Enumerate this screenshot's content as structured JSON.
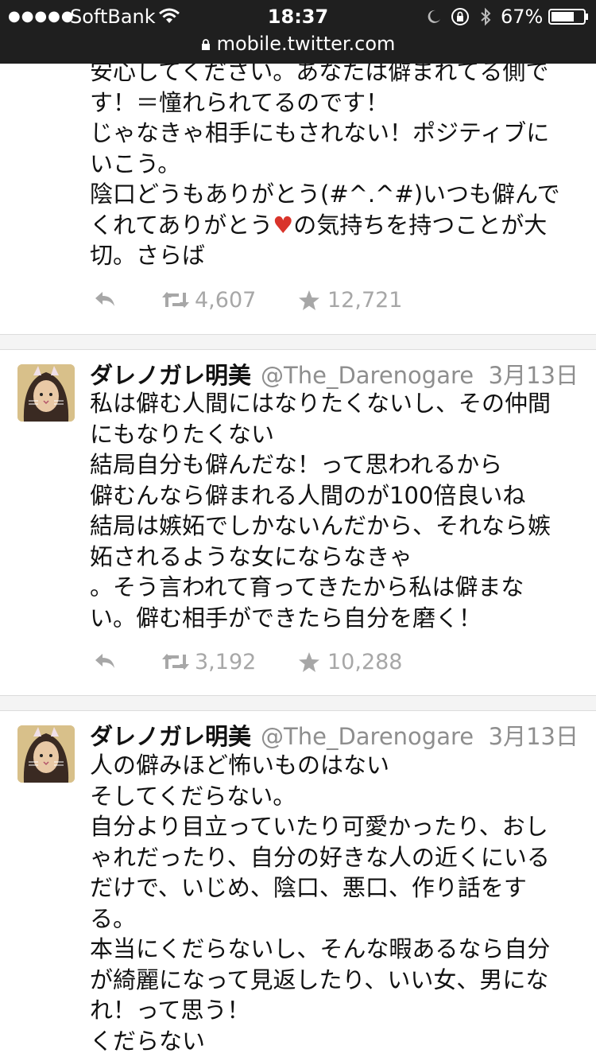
{
  "status_bar": {
    "signal": "●●●●●",
    "carrier": "SoftBank",
    "time": "18:37",
    "battery": "67%",
    "url": "mobile.twitter.com"
  },
  "tweets": [
    {
      "text": "安心してください。あなたは僻まれてる側です！＝憧れられてるのです！\nじゃなきゃ相手にもされない！ポジティブにいこう。\n陰口どうもありがとう(#^.^#)いつも僻んでくれてありがとう",
      "text_after_heart": "の気持ちを持つことが大切。さらば",
      "retweets": "4,607",
      "favorites": "12,721"
    },
    {
      "name": "ダレノガレ明美",
      "handle": "@The_Darenogare",
      "date": "3月13日",
      "text": "私は僻む人間にはなりたくないし、その仲間にもなりたくない\n結局自分も僻んだな！って思われるから\n僻むんなら僻まれる人間のが100倍良いね\n結局は嫉妬でしかないんだから、それなら嫉妬されるような女にならなきゃ\n。そう言われて育ってきたから私は僻まない。僻む相手ができたら自分を磨く！",
      "retweets": "3,192",
      "favorites": "10,288"
    },
    {
      "name": "ダレノガレ明美",
      "handle": "@The_Darenogare",
      "date": "3月13日",
      "text": "人の僻みほど怖いものはない\nそしてくだらない。\n自分より目立っていたり可愛かったり、おしゃれだったり、自分の好きな人の近くにいるだけで、いじめ、陰口、悪口、作り話をする。\n本当にくだらないし、そんな暇あるなら自分が綺麗になって見返したり、いい女、男になれ！って思う！\nくだらない"
    }
  ],
  "colors": {
    "status_bg": "#1f1f1f",
    "text": "#111111",
    "muted": "#8e8e8e",
    "action": "#a7a7a7",
    "heart": "#d9342b"
  },
  "icons": [
    "wifi-icon",
    "moon-icon",
    "rotation-lock-icon",
    "bluetooth-icon",
    "battery-icon",
    "lock-icon",
    "reply-icon",
    "retweet-icon",
    "star-icon",
    "heart-emoji"
  ]
}
